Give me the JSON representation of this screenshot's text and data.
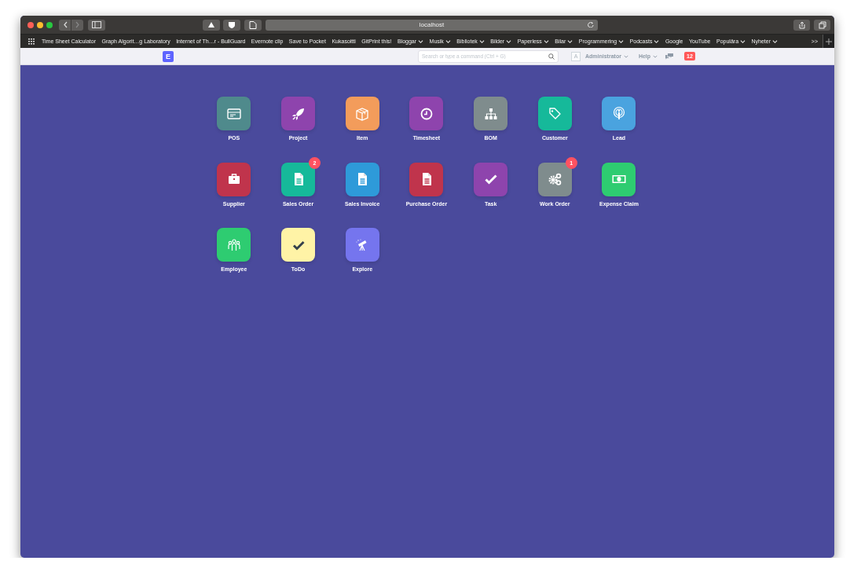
{
  "browser": {
    "address": "localhost"
  },
  "bookmarks": [
    {
      "label": "Time Sheet Calculator",
      "dropdown": false
    },
    {
      "label": "Graph Algorit…g Laboratory",
      "dropdown": false
    },
    {
      "label": "Internet of Th…r - BullGuard",
      "dropdown": false
    },
    {
      "label": "Evernote clip",
      "dropdown": false
    },
    {
      "label": "Save to Pocket",
      "dropdown": false
    },
    {
      "label": "Kukasoitti",
      "dropdown": false
    },
    {
      "label": "GitPrint this!",
      "dropdown": false
    },
    {
      "label": "Bloggar",
      "dropdown": true
    },
    {
      "label": "Musik",
      "dropdown": true
    },
    {
      "label": "Bibliotek",
      "dropdown": true
    },
    {
      "label": "Bilder",
      "dropdown": true
    },
    {
      "label": "Paperless",
      "dropdown": true
    },
    {
      "label": "Bilar",
      "dropdown": true
    },
    {
      "label": "Programmering",
      "dropdown": true
    },
    {
      "label": "Podcasts",
      "dropdown": true
    },
    {
      "label": "Google",
      "dropdown": false
    },
    {
      "label": "YouTube",
      "dropdown": false
    },
    {
      "label": "Populära",
      "dropdown": true
    },
    {
      "label": "Nyheter",
      "dropdown": true
    }
  ],
  "bookmarks_more": ">>",
  "navbar": {
    "logo": "E",
    "search": {
      "placeholder": "Search or type a command (Ctrl + G)"
    },
    "avatar": "A",
    "user": "Administrator",
    "help": "Help",
    "notifications": "12"
  },
  "apps": [
    {
      "label": "POS",
      "color": "#4f8a8c"
    },
    {
      "label": "Project",
      "color": "#8e44ad"
    },
    {
      "label": "Item",
      "color": "#f39c5b"
    },
    {
      "label": "Timesheet",
      "color": "#8e44ad"
    },
    {
      "label": "BOM",
      "color": "#7f8c8d"
    },
    {
      "label": "Customer",
      "color": "#16b99a"
    },
    {
      "label": "Lead",
      "color": "#4aa3df"
    },
    {
      "label": "Supplier",
      "color": "#c0344c"
    },
    {
      "label": "Sales Order",
      "color": "#16b99a",
      "badge": "2"
    },
    {
      "label": "Sales Invoice",
      "color": "#2e9ad9"
    },
    {
      "label": "Purchase Order",
      "color": "#c0344c"
    },
    {
      "label": "Task",
      "color": "#8e44ad"
    },
    {
      "label": "Work Order",
      "color": "#7f8c8d",
      "badge": "1"
    },
    {
      "label": "Expense Claim",
      "color": "#2ecc71"
    },
    {
      "label": "Employee",
      "color": "#2ecc71"
    },
    {
      "label": "ToDo",
      "color": "#fff3a6"
    },
    {
      "label": "Explore",
      "color": "#7575ee"
    }
  ]
}
